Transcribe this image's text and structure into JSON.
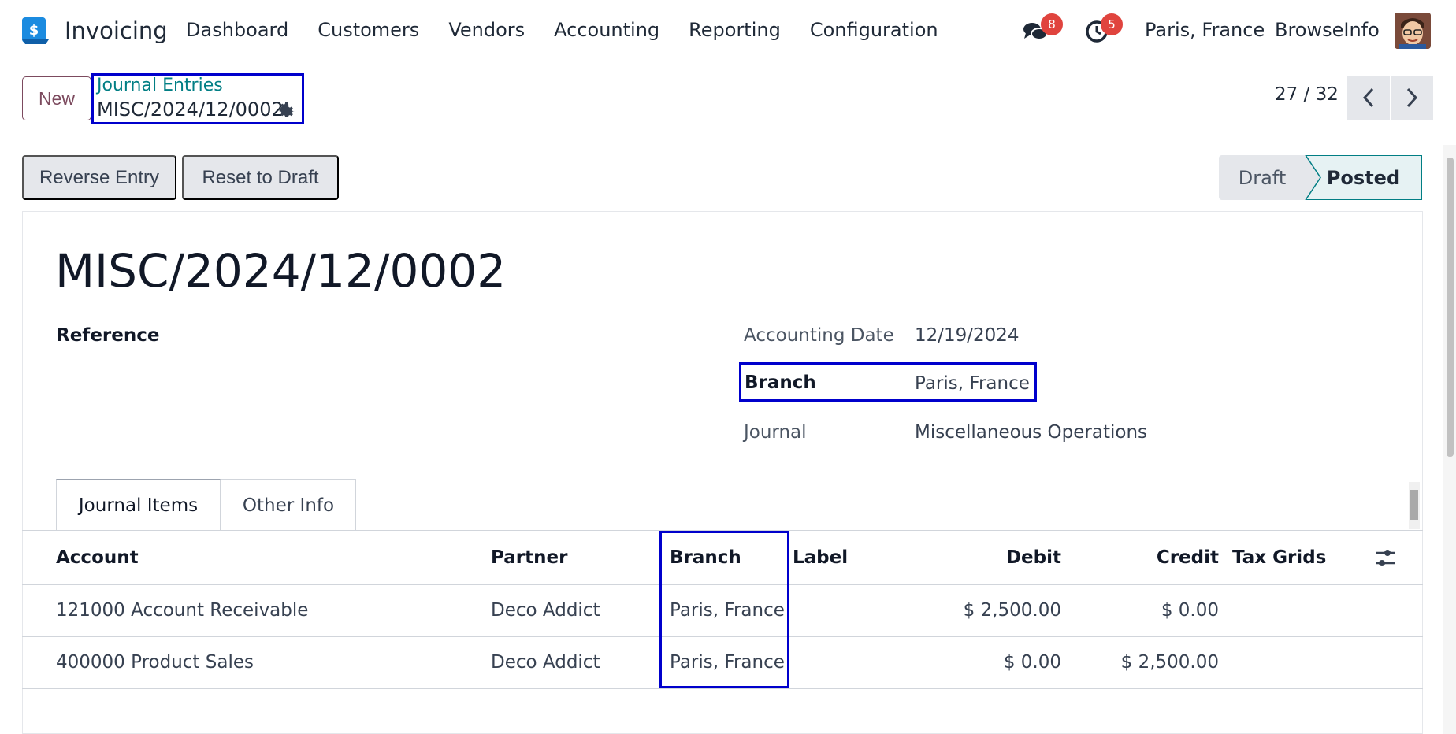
{
  "navbar": {
    "app_name": "Invoicing",
    "menu": [
      "Dashboard",
      "Customers",
      "Vendors",
      "Accounting",
      "Reporting",
      "Configuration"
    ],
    "messages_count": "8",
    "activities_count": "5",
    "company": "Paris, France",
    "user": "BrowseInfo"
  },
  "control": {
    "new_label": "New",
    "breadcrumb_parent": "Journal Entries",
    "breadcrumb_current": "MISC/2024/12/0002",
    "pager": "27 / 32"
  },
  "actions": {
    "reverse": "Reverse Entry",
    "reset": "Reset to Draft"
  },
  "status": {
    "draft": "Draft",
    "posted": "Posted",
    "current": "Posted"
  },
  "record": {
    "title": "MISC/2024/12/0002",
    "reference_label": "Reference",
    "accounting_date_label": "Accounting Date",
    "accounting_date": "12/19/2024",
    "branch_label": "Branch",
    "branch": "Paris, France",
    "journal_label": "Journal",
    "journal": "Miscellaneous Operations"
  },
  "tabs": [
    "Journal Items",
    "Other Info"
  ],
  "table": {
    "headers": [
      "Account",
      "Partner",
      "Branch",
      "Label",
      "Debit",
      "Credit",
      "Tax Grids"
    ],
    "rows": [
      {
        "account": "121000 Account Receivable",
        "partner": "Deco Addict",
        "branch": "Paris, France",
        "label": "",
        "debit": "$ 2,500.00",
        "credit": "$ 0.00",
        "tax": ""
      },
      {
        "account": "400000 Product Sales",
        "partner": "Deco Addict",
        "branch": "Paris, France",
        "label": "",
        "debit": "$ 0.00",
        "credit": "$ 2,500.00",
        "tax": ""
      }
    ]
  },
  "colors": {
    "highlight": "#0000cc",
    "brand": "#7c4a5e",
    "link": "#017e84",
    "badge": "#e0443e"
  }
}
